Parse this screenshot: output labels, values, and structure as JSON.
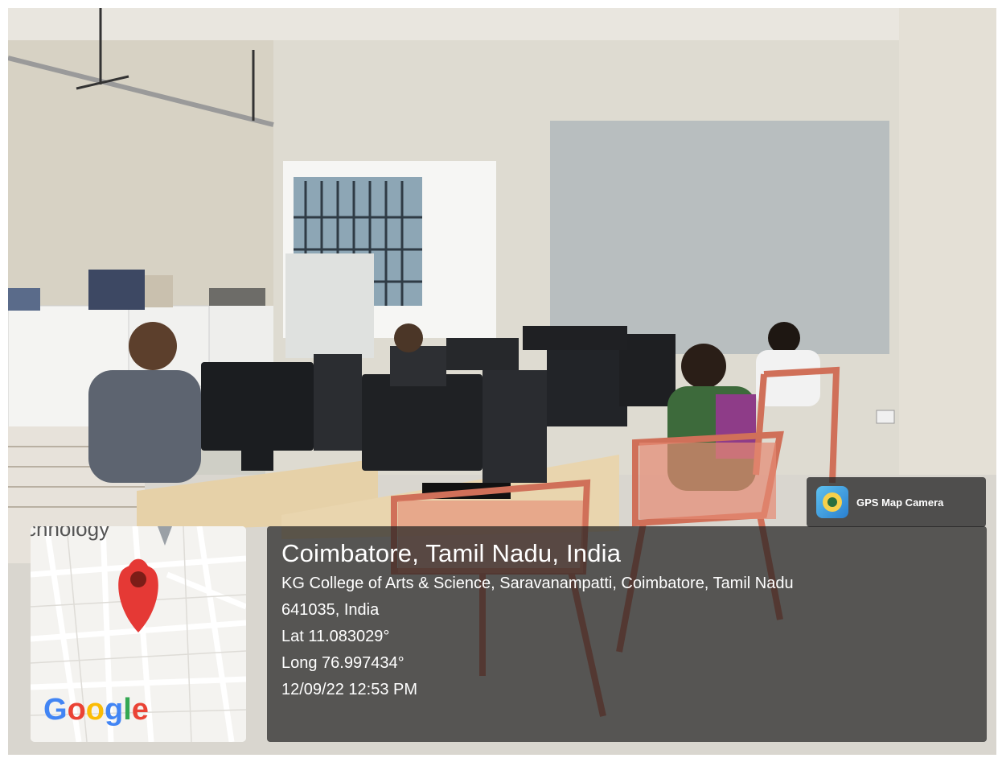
{
  "stamp": {
    "app_name": "GPS Map Camera",
    "headline": "Coimbatore, Tamil Nadu, India",
    "address_line1": "KG College of Arts & Science, Saravanampatti, Coimbatore, Tamil Nadu",
    "address_line2": "641035, India",
    "lat": "Lat 11.083029°",
    "long": "Long 76.997434°",
    "datetime": "12/09/22 12:53 PM"
  },
  "map": {
    "label_fragment": "chnology",
    "logo_letters": [
      "G",
      "o",
      "o",
      "g",
      "l",
      "e"
    ],
    "pin_color": "#E53935"
  },
  "icons": {
    "app": "gps-map-camera-icon",
    "pin": "map-pin-icon"
  }
}
